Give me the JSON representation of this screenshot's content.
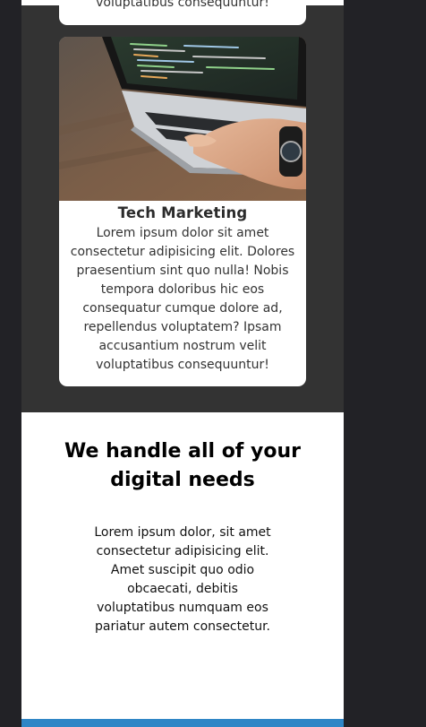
{
  "cards": {
    "previous": {
      "text": "voluptatibus consequuntur!"
    },
    "main": {
      "image": "laptop-coding-photo",
      "title": "Tech Marketing",
      "text": "Lorem ipsum dolor sit amet consectetur adipisicing elit. Dolores praesentium sint quo nulla! Nobis tempora doloribus hic eos consequatur cumque dolore ad, repellendus voluptatem? Ipsam accusantium nostrum velit voluptatibus consequuntur!"
    }
  },
  "digital_section": {
    "title": "We handle all of your digital needs",
    "text": "Lorem ipsum dolor, sit amet consectetur adipisicing elit. Amet suscipit quo odio obcaecati, debitis voluptatibus numquam eos pariatur autem consectetur."
  },
  "colors": {
    "page_background": "#222226",
    "services_background": "#333333",
    "card_background": "#ffffff",
    "accent_bar": "#2f86c6"
  }
}
